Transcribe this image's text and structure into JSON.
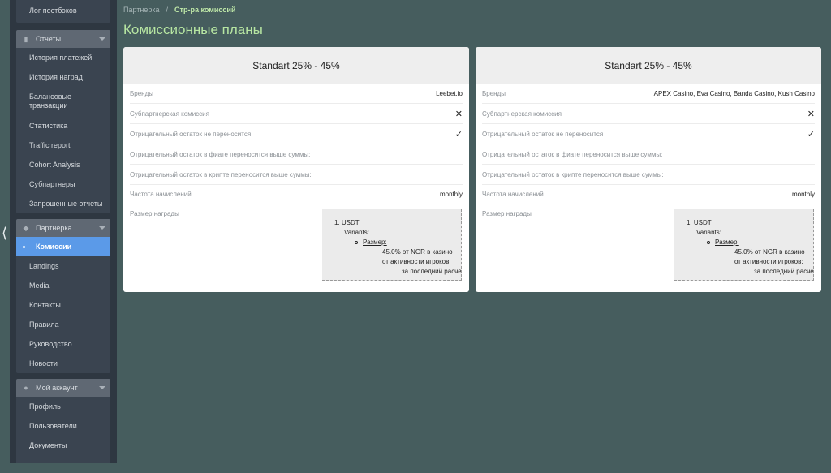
{
  "sidebar": {
    "top_item": "Лог постбэков",
    "reports": {
      "header": "Отчеты",
      "items": [
        "История платежей",
        "История наград",
        "Балансовые транзакции",
        "Статистика",
        "Traffic report",
        "Cohort Analysis",
        "Субпартнеры",
        "Запрошенные отчеты"
      ]
    },
    "partner": {
      "header": "Партнерка",
      "items": [
        "Комиссии",
        "Landings",
        "Media",
        "Контакты",
        "Правила",
        "Руководство",
        "Новости"
      ]
    },
    "account": {
      "header": "Мой аккаунт",
      "items": [
        "Профиль",
        "Пользователи",
        "Документы"
      ]
    },
    "collapse_glyph": "⟨"
  },
  "breadcrumb": {
    "root": "Партнерка",
    "separator": "/",
    "current": "Стр-ра комиссий"
  },
  "page_title": "Комиссионные планы",
  "labels": {
    "brands": "Бренды",
    "subpartner": "Субпартнерская комиссия",
    "negative_no_carry": "Отрицательный остаток не переносится",
    "negative_fiat": "Отрицательный остаток в фиате переносится выше суммы:",
    "negative_crypto": "Отрицательный остаток в крипте переносится выше суммы:",
    "frequency": "Частота начислений",
    "reward_size": "Размер награды"
  },
  "plans": [
    {
      "title": "Standart 25% - 45%",
      "brands": "Leebet.io",
      "subpartner_mark": "✕",
      "no_carry_mark": "✓",
      "frequency": "monthly",
      "reward": {
        "l1": "1.  USDT",
        "l2": "Variants:",
        "l3": "Размер:",
        "l4": "45.0% от NGR в казино",
        "l5": "от активности игроков:",
        "l6": "за последний расчет"
      }
    },
    {
      "title": "Standart 25% - 45%",
      "brands": "APEX Casino, Eva Casino, Banda Casino, Kush Casino",
      "subpartner_mark": "✕",
      "no_carry_mark": "✓",
      "frequency": "monthly",
      "reward": {
        "l1": "1.  USDT",
        "l2": "Variants:",
        "l3": "Размер:",
        "l4": "45.0% от NGR в казино",
        "l5": "от активности игроков:",
        "l6": "за последний расчет"
      }
    }
  ],
  "colors": {
    "background": "#465d5e",
    "sidebar": "#2e3741",
    "active_item": "#5b9ae8",
    "title_green": "#b7e6a2"
  }
}
